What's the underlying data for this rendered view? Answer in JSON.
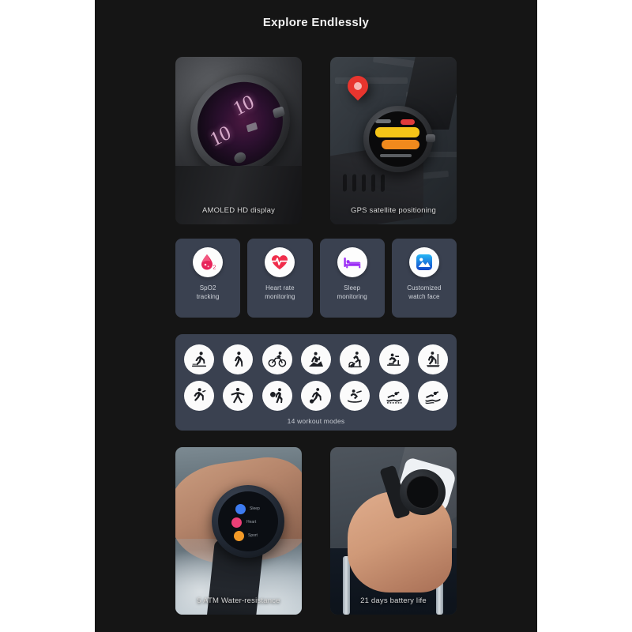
{
  "page": {
    "title": "Explore Endlessly",
    "background_color": "#151515",
    "card_color": "#3a4150",
    "caption_color": "#d8d8d8"
  },
  "hero_cards": [
    {
      "name": "amoled",
      "caption": "AMOLED HD display",
      "watch_face_digits": [
        "10",
        "10"
      ],
      "accent_color": "#e7b9d8"
    },
    {
      "name": "gps",
      "caption": "GPS satellite positioning",
      "pin_color": "#e8352e",
      "accent_color": "#f5a623"
    }
  ],
  "features": [
    {
      "icon": "spo2-drop-icon",
      "label_line1": "SpO2",
      "label_line2": "tracking",
      "color": "#e8235a"
    },
    {
      "icon": "heart-rate-icon",
      "label_line1": "Heart rate",
      "label_line2": "monitoring",
      "color": "#f02d4b"
    },
    {
      "icon": "sleep-bed-icon",
      "label_line1": "Sleep",
      "label_line2": "monitoring",
      "color": "#9b2cf5"
    },
    {
      "icon": "watch-face-icon",
      "label_line1": "Customized",
      "label_line2": "watch face",
      "color": "#1a7fe8"
    }
  ],
  "workouts": {
    "caption": "14 workout modes",
    "row1": [
      {
        "icon": "running-icon",
        "label": "Running"
      },
      {
        "icon": "walking-icon",
        "label": "Walking"
      },
      {
        "icon": "cycling-icon",
        "label": "Cycling"
      },
      {
        "icon": "climbing-icon",
        "label": "Climbing"
      },
      {
        "icon": "spinning-icon",
        "label": "Indoor cycling"
      },
      {
        "icon": "rowing-machine-icon",
        "label": "Rowing machine"
      },
      {
        "icon": "treadmill-icon",
        "label": "Treadmill"
      }
    ],
    "row2": [
      {
        "icon": "exercise-icon",
        "label": "Free training"
      },
      {
        "icon": "yoga-icon",
        "label": "Yoga"
      },
      {
        "icon": "basketball-icon",
        "label": "Basketball"
      },
      {
        "icon": "football-icon",
        "label": "Football"
      },
      {
        "icon": "kayaking-icon",
        "label": "Rowing"
      },
      {
        "icon": "pool-swim-icon",
        "label": "Pool swimming"
      },
      {
        "icon": "open-water-icon",
        "label": "Open water swimming"
      }
    ]
  },
  "bottom_cards": [
    {
      "name": "water-resistance",
      "caption": "5 ATM Water-resistance"
    },
    {
      "name": "battery-life",
      "caption": "21 days battery life"
    }
  ]
}
